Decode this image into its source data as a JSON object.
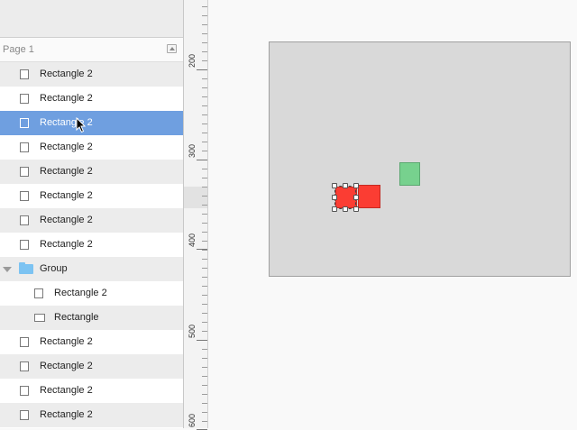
{
  "sidebar": {
    "page_label": "Page 1",
    "layers": [
      {
        "label": "Rectangle 2",
        "indent": 0,
        "icon": "rectangle-icon",
        "selected": false
      },
      {
        "label": "Rectangle 2",
        "indent": 0,
        "icon": "rectangle-icon",
        "selected": false
      },
      {
        "label": "Rectangle 2",
        "indent": 0,
        "icon": "rectangle-icon",
        "selected": true
      },
      {
        "label": "Rectangle 2",
        "indent": 0,
        "icon": "rectangle-icon",
        "selected": false
      },
      {
        "label": "Rectangle 2",
        "indent": 0,
        "icon": "rectangle-icon",
        "selected": false
      },
      {
        "label": "Rectangle 2",
        "indent": 0,
        "icon": "rectangle-icon",
        "selected": false
      },
      {
        "label": "Rectangle 2",
        "indent": 0,
        "icon": "rectangle-icon",
        "selected": false
      },
      {
        "label": "Rectangle 2",
        "indent": 0,
        "icon": "rectangle-icon",
        "selected": false
      },
      {
        "label": "Group",
        "indent": 0,
        "icon": "folder-icon",
        "selected": false
      },
      {
        "label": "Rectangle 2",
        "indent": 1,
        "icon": "rectangle-icon",
        "selected": false
      },
      {
        "label": "Rectangle",
        "indent": 1,
        "icon": "rectangle-wide-icon",
        "selected": false
      },
      {
        "label": "Rectangle 2",
        "indent": 0,
        "icon": "rectangle-icon",
        "selected": false
      },
      {
        "label": "Rectangle 2",
        "indent": 0,
        "icon": "rectangle-icon",
        "selected": false
      },
      {
        "label": "Rectangle 2",
        "indent": 0,
        "icon": "rectangle-icon",
        "selected": false
      },
      {
        "label": "Rectangle 2",
        "indent": 0,
        "icon": "rectangle-icon",
        "selected": false
      }
    ]
  },
  "ruler": {
    "labels": [
      "200",
      "300",
      "400",
      "500",
      "600"
    ]
  },
  "colors": {
    "selection": "#6f9fe0",
    "red_shape": "#fb3d33",
    "green_shape": "#77d18e",
    "artboard": "#d9d9d9",
    "folder": "#7cc3f2"
  }
}
